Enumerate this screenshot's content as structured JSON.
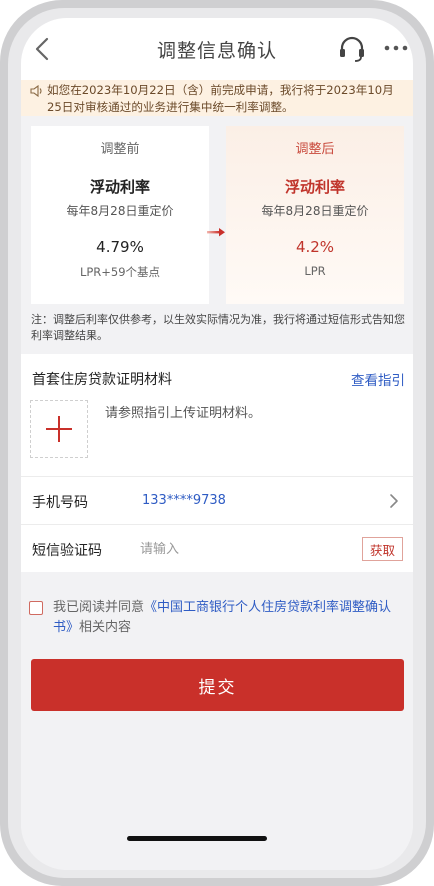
{
  "header": {
    "title": "调整信息确认",
    "back_icon": "back-chevron-icon",
    "support_icon": "headset-icon",
    "more_icon": "more-dots-icon"
  },
  "notice": {
    "icon": "speaker-icon",
    "text": "如您在2023年10月22日（含）前完成申请，我行将于2023年10月25日对审核通过的业务进行集中统一利率调整。"
  },
  "compare": {
    "before": {
      "label": "调整前",
      "type": "浮动利率",
      "reset": "每年8月28日重定价",
      "rate": "4.79%",
      "base": "LPR+59个基点"
    },
    "after": {
      "label": "调整后",
      "type": "浮动利率",
      "reset": "每年8月28日重定价",
      "rate": "4.2%",
      "base": "LPR"
    },
    "note": "注：调整后利率仅供参考，以生效实际情况为准，我行将通过短信形式告知您利率调整结果。"
  },
  "upload": {
    "title": "首套住房贷款证明材料",
    "guide_link": "查看指引",
    "hint": "请参照指引上传证明材料。"
  },
  "form": {
    "phone_label": "手机号码",
    "phone_value": "133****9738",
    "code_label": "短信验证码",
    "code_placeholder": "请输入",
    "code_value": "",
    "get_code_label": "获取"
  },
  "agreement": {
    "checked": false,
    "prefix": "我已阅读并同意",
    "link": "《中国工商银行个人住房贷款利率调整确认书》",
    "suffix": "相关内容"
  },
  "submit_label": "提交",
  "colors": {
    "accent_red": "#c9302a",
    "link_blue": "#2f5cc4",
    "notice_bg": "#fdf1e2"
  }
}
